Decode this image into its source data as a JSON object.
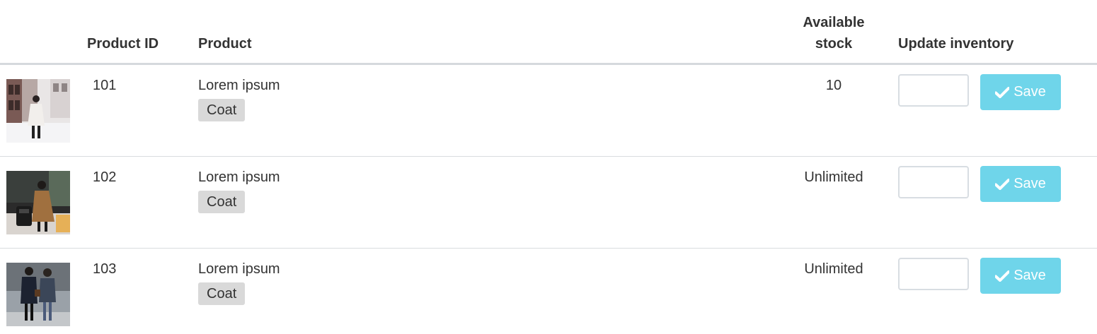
{
  "table": {
    "headers": {
      "product_id": "Product ID",
      "product": "Product",
      "available_stock": "Available stock",
      "update_inventory": "Update inventory"
    },
    "rows": [
      {
        "thumbnail_icon": "product-photo-woman-white-coat-street",
        "product_id": "101",
        "product_name": "Lorem ipsum",
        "tag": "Coat",
        "available_stock": "10",
        "quantity_value": "",
        "save_label": "Save"
      },
      {
        "thumbnail_icon": "product-photo-woman-camel-coat-luggage",
        "product_id": "102",
        "product_name": "Lorem ipsum",
        "tag": "Coat",
        "available_stock": "Unlimited",
        "quantity_value": "",
        "save_label": "Save"
      },
      {
        "thumbnail_icon": "product-photo-couple-dark-coats",
        "product_id": "103",
        "product_name": "Lorem ipsum",
        "tag": "Coat",
        "available_stock": "Unlimited",
        "quantity_value": "",
        "save_label": "Save"
      }
    ],
    "colors": {
      "save_button": "#6fd5ea",
      "tag_background": "#d9d9d9",
      "header_rule": "#d5d9dd"
    }
  }
}
